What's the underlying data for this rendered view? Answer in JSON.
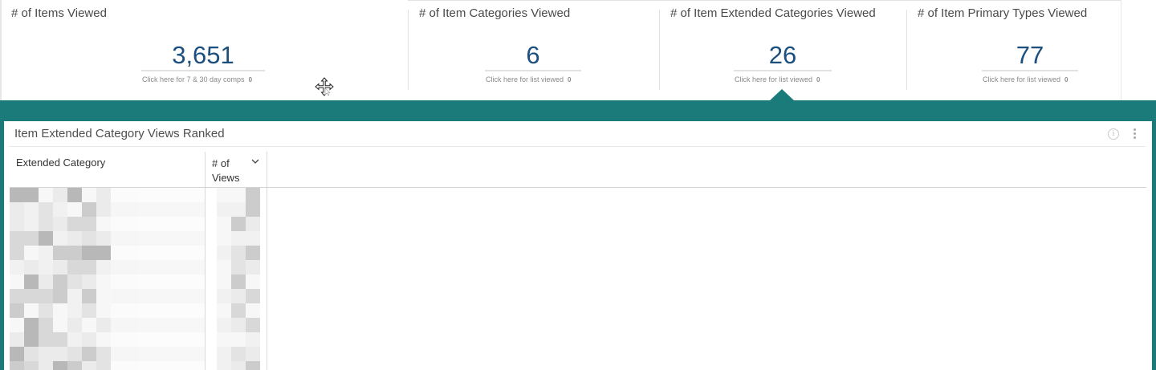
{
  "kpis": [
    {
      "title": "# of Items Viewed",
      "value": "3,651",
      "link": "Click here for 7 & 30 day comps",
      "badge": "0"
    },
    {
      "title": "# of Item Categories Viewed",
      "value": "6",
      "link": "Click here for list viewed",
      "badge": "0"
    },
    {
      "title": "# of Item Extended Categories Viewed",
      "value": "26",
      "link": "Click here for list viewed",
      "badge": "0"
    },
    {
      "title": "# of Item Primary Types Viewed",
      "value": "77",
      "link": "Click here for list viewed",
      "badge": "0"
    }
  ],
  "panel": {
    "title": "Item Extended Category Views Ranked",
    "info_icon": "info-icon",
    "menu_icon": "kebab-menu-icon",
    "columns": [
      {
        "label": "Extended Category"
      },
      {
        "label": "# of Views",
        "sort": "descending"
      }
    ],
    "rows_obscured": true
  },
  "colors": {
    "accent_teal": "#1b7b7a",
    "kpi_value": "#1c4f7e"
  }
}
